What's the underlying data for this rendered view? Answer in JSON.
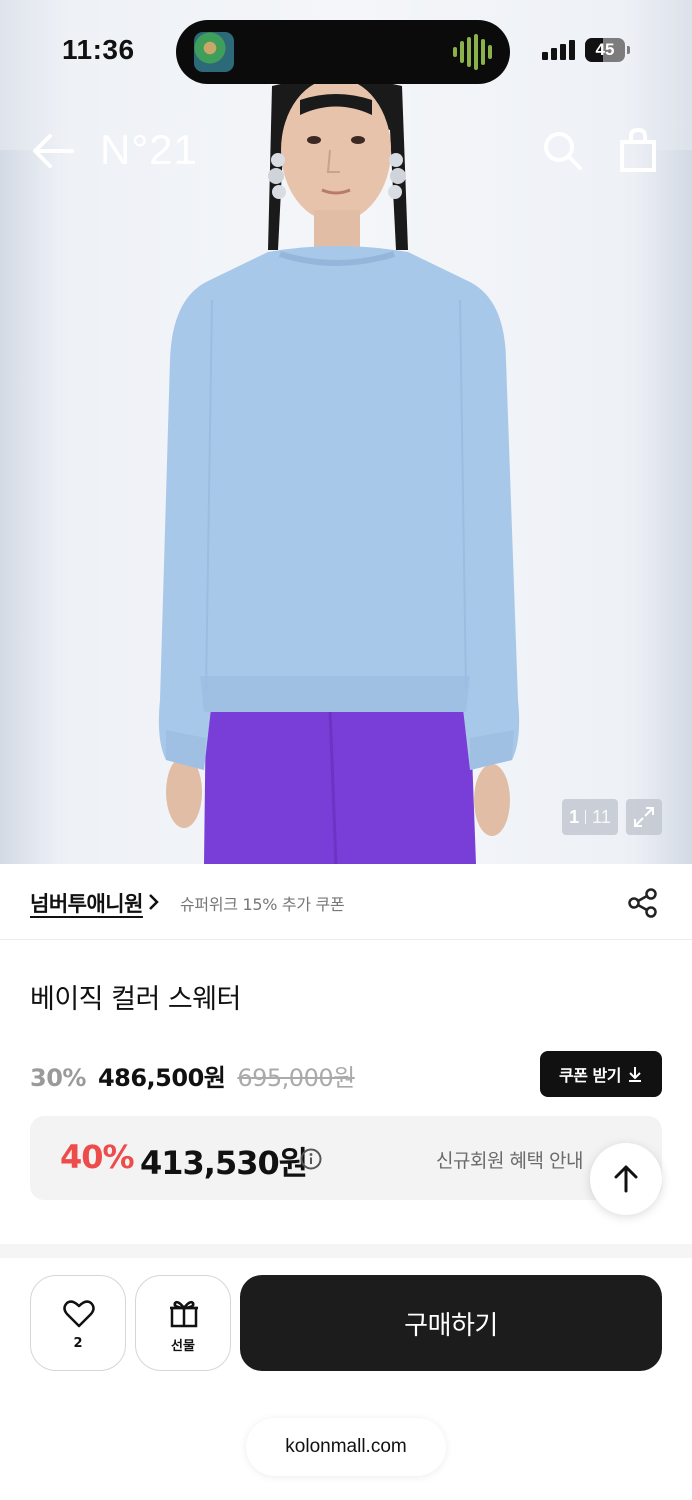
{
  "status_bar": {
    "time": "11:36",
    "battery": "45",
    "icons": [
      "now-playing-art",
      "audio-waveform-icon",
      "cellular-signal-icon",
      "battery-icon"
    ]
  },
  "header": {
    "logo": "N°21",
    "icons": [
      "back-arrow-icon",
      "search-icon",
      "shopping-bag-icon"
    ],
    "logo_color": "#ffffff"
  },
  "gallery": {
    "current": "1",
    "total": "11",
    "icons": [
      "expand-icon"
    ]
  },
  "brand": {
    "name": "넘버투애니원",
    "promo": "슈퍼위크 15% 추가 쿠폰",
    "icons": [
      "chevron-right-icon",
      "share-icon"
    ]
  },
  "product": {
    "title": "베이직 컬러 스웨터",
    "discount_rate": "30%",
    "price": "486,500원",
    "original_price": "695,000원",
    "coupon_label": "쿠폰 받기",
    "coupon_icon": "download-icon"
  },
  "member_offer": {
    "rate": "40%",
    "price": "413,530원",
    "note": "신규회원 혜택 안내",
    "rate_color": "#ee4b4b",
    "icons": [
      "info-icon"
    ]
  },
  "scroll_top": {
    "icon": "arrow-up-icon"
  },
  "bottom_bar": {
    "wish_count": "2",
    "gift_label": "선물",
    "buy_label": "구매하기",
    "buy_color": "#1c1c1c",
    "icons": [
      "heart-icon",
      "gift-icon"
    ]
  },
  "browser": {
    "url": "kolonmall.com"
  }
}
